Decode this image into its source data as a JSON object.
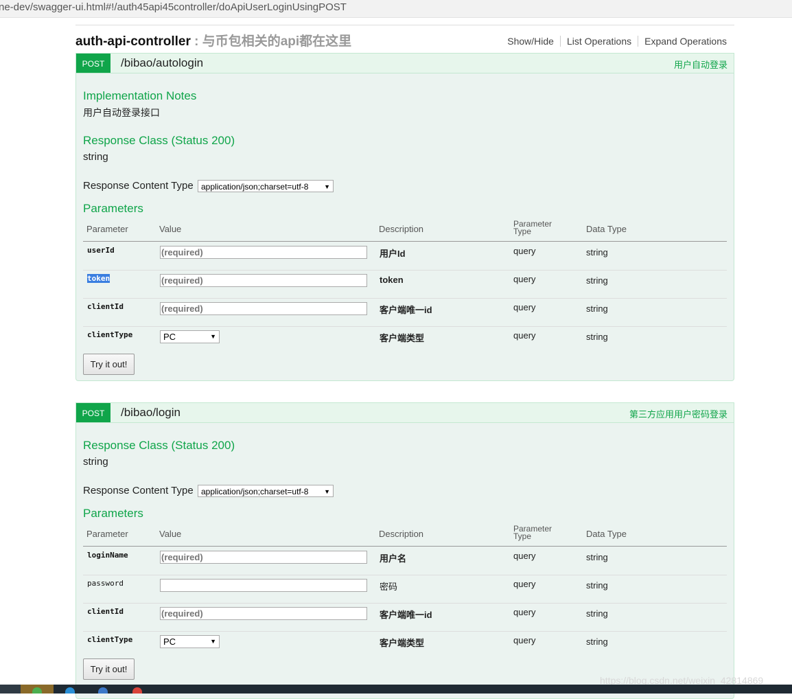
{
  "browser": {
    "url": "ne-dev/swagger-ui.html#!/auth45api45controller/doApiUserLoginUsingPOST"
  },
  "controller": {
    "name": "auth-api-controller",
    "separator": " : ",
    "description": "与币包相关的api都在这里",
    "actions": [
      "Show/Hide",
      "List Operations",
      "Expand Operations"
    ]
  },
  "operations": [
    {
      "method": "POST",
      "path": "/bibao/autologin",
      "summary": "用户自动登录",
      "notes_title": "Implementation Notes",
      "notes": "用户自动登录接口",
      "response_title": "Response Class (Status 200)",
      "response_type": "string",
      "content_type_label": "Response Content Type",
      "content_type": "application/json;charset=utf-8",
      "parameters_title": "Parameters",
      "columns": {
        "parameter": "Parameter",
        "value": "Value",
        "description": "Description",
        "ptype_1": "Parameter",
        "ptype_2": "Type",
        "data_type": "Data Type"
      },
      "params": [
        {
          "name": "userId",
          "value": "(required)",
          "description": "用户Id",
          "type": "query",
          "data_type": "string"
        },
        {
          "name": "token",
          "value": "(required)",
          "description": "token",
          "type": "query",
          "data_type": "string"
        },
        {
          "name": "clientId",
          "value": "(required)",
          "description": "客户端唯一id",
          "type": "query",
          "data_type": "string"
        },
        {
          "name": "clientType",
          "value": "PC",
          "description": "客户端类型",
          "type": "query",
          "data_type": "string"
        }
      ],
      "try_label": "Try it out!"
    },
    {
      "method": "POST",
      "path": "/bibao/login",
      "summary": "第三方应用用户密码登录",
      "response_title": "Response Class (Status 200)",
      "response_type": "string",
      "content_type_label": "Response Content Type",
      "content_type": "application/json;charset=utf-8",
      "parameters_title": "Parameters",
      "columns": {
        "parameter": "Parameter",
        "value": "Value",
        "description": "Description",
        "ptype_1": "Parameter",
        "ptype_2": "Type",
        "data_type": "Data Type"
      },
      "params": [
        {
          "name": "loginName",
          "value": "(required)",
          "description": "用户名",
          "type": "query",
          "data_type": "string"
        },
        {
          "name": "password",
          "value": "",
          "description": "密码",
          "type": "query",
          "data_type": "string"
        },
        {
          "name": "clientId",
          "value": "(required)",
          "description": "客户端唯一id",
          "type": "query",
          "data_type": "string"
        },
        {
          "name": "clientType",
          "value": "PC",
          "description": "客户端类型",
          "type": "query",
          "data_type": "string"
        }
      ],
      "try_label": "Try it out!"
    }
  ],
  "watermark": "https://blog.csdn.net/weixin_42814869",
  "colors": {
    "post": "#10a54a",
    "op_background": "#ebf3f0",
    "op_border": "#c3e8d1"
  }
}
